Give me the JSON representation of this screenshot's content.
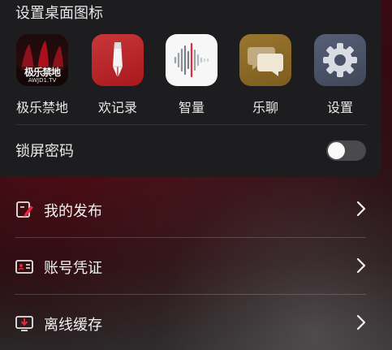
{
  "panel": {
    "title": "设置桌面图标",
    "apps": [
      {
        "label": "极乐禁地",
        "icon": "jile-jindi-app-icon",
        "icon_text": "极乐禁地",
        "icon_subtext": "AWJD1.TV"
      },
      {
        "label": "欢记录",
        "icon": "pen-nib-app-icon"
      },
      {
        "label": "智量",
        "icon": "soundwave-app-icon"
      },
      {
        "label": "乐聊",
        "icon": "chat-bubbles-app-icon"
      },
      {
        "label": "设置",
        "icon": "gear-app-icon"
      }
    ],
    "lock_label": "锁屏密码",
    "lock_enabled": false
  },
  "menu": {
    "items": [
      {
        "label": "我的发布",
        "icon": "edit-document-icon"
      },
      {
        "label": "账号凭证",
        "icon": "id-card-icon"
      },
      {
        "label": "离线缓存",
        "icon": "download-monitor-icon"
      }
    ]
  },
  "colors": {
    "panel_bg": "#1d1d1f",
    "accent_red": "#e5283a",
    "chat_icon_bg": "#8c6a26",
    "settings_icon_bg": "#4a5268"
  }
}
